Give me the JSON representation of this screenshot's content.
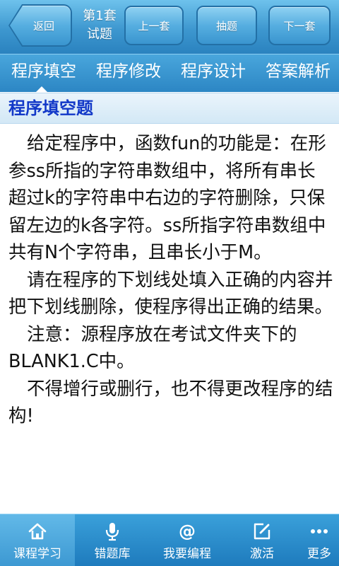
{
  "toolbar": {
    "back_label": "返回",
    "set_label_line1": "第1套",
    "set_label_line2": "试题",
    "prev_label": "上一套",
    "draw_label": "抽题",
    "next_label": "下一套"
  },
  "tabs": [
    {
      "label": "程序填空",
      "active": true
    },
    {
      "label": "程序修改",
      "active": false
    },
    {
      "label": "程序设计",
      "active": false
    },
    {
      "label": "答案解析",
      "active": false
    }
  ],
  "section": {
    "title": "程序填空题"
  },
  "content": {
    "paragraphs": [
      "给定程序中，函数fun的功能是：在形参ss所指的字符串数组中，将所有串长超过k的字符串中右边的字符删除，只保留左边的k各字符。ss所指字符串数组中共有N个字符串，且串长小于M。",
      "请在程序的下划线处填入正确的内容并把下划线删除，使程序得出正确的结果。",
      "注意：源程序放在考试文件夹下的BLANK1.C中。",
      "不得增行或删行，也不得更改程序的结构!"
    ]
  },
  "bottom_nav": [
    {
      "label": "课程学习",
      "icon": "home-icon",
      "active": true
    },
    {
      "label": "错题库",
      "icon": "microphone-icon",
      "active": false
    },
    {
      "label": "我要编程",
      "icon": "at-sign-icon",
      "active": false
    },
    {
      "label": "激活",
      "icon": "edit-icon",
      "active": false
    },
    {
      "label": "更多",
      "icon": "more-dots-icon",
      "active": false
    }
  ],
  "colors": {
    "bar_blue": "#3d97cf",
    "title_blue": "#1238c8",
    "text": "#111111"
  }
}
